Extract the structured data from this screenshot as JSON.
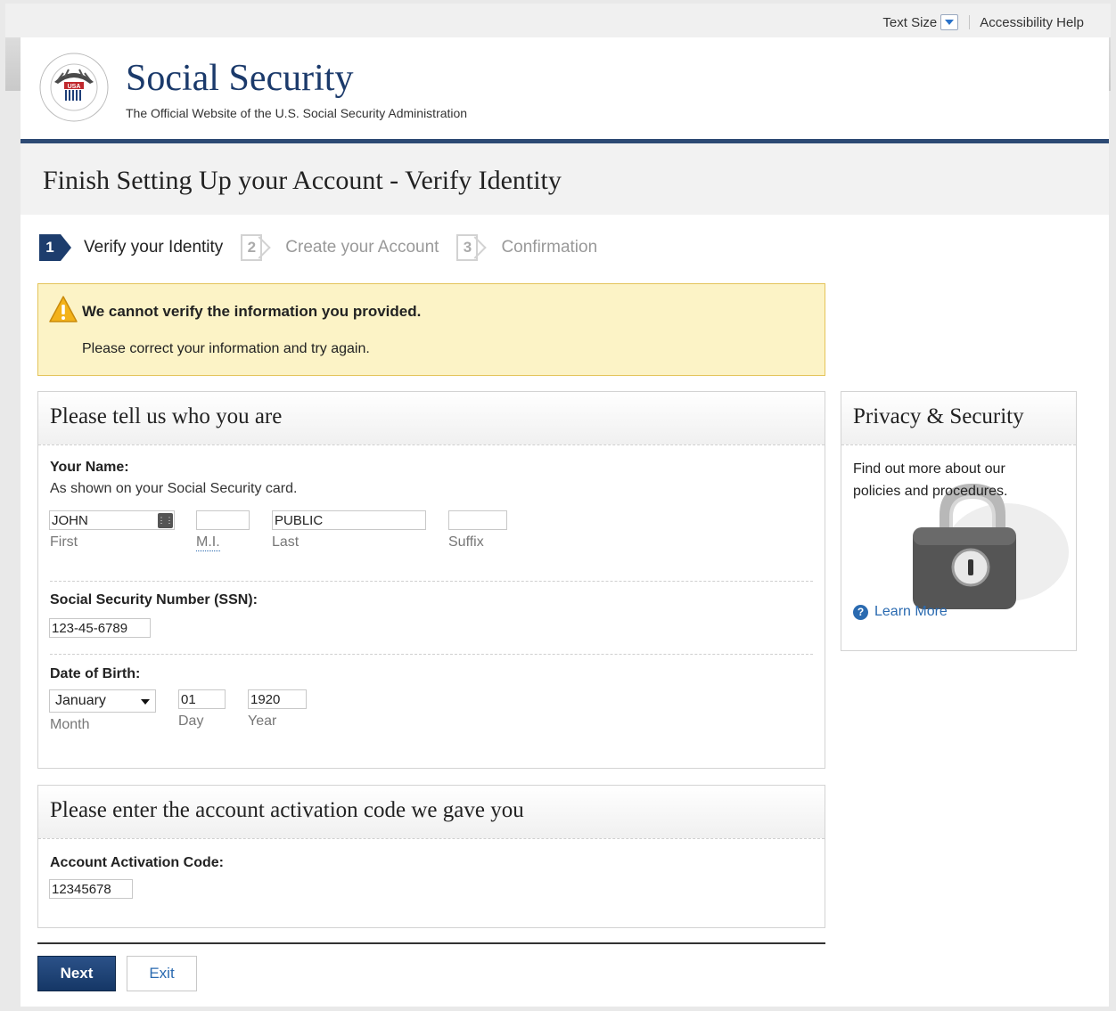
{
  "utility": {
    "text_size_label": "Text Size",
    "accessibility_label": "Accessibility Help"
  },
  "header": {
    "site_title": "Social Security",
    "site_subtitle": "The Official Website of the U.S. Social Security Administration",
    "seal_text": "SOCIAL SECURITY ADMINISTRATION",
    "seal_usa": "USA"
  },
  "page": {
    "title": "Finish Setting Up your Account - Verify Identity"
  },
  "steps": [
    {
      "number": "1",
      "label": "Verify your Identity",
      "state": "active"
    },
    {
      "number": "2",
      "label": "Create your Account",
      "state": "inactive"
    },
    {
      "number": "3",
      "label": "Confirmation",
      "state": "inactive"
    }
  ],
  "alert": {
    "title": "We cannot verify the information you provided.",
    "message": "Please correct your information and try again."
  },
  "identity_panel": {
    "heading": "Please tell us who you are",
    "name": {
      "label": "Your Name:",
      "hint": "As shown on your Social Security card.",
      "first_value": "JOHN",
      "first_label": "First",
      "mi_value": "",
      "mi_label": "M.I.",
      "last_value": "PUBLIC",
      "last_label": "Last",
      "suffix_value": "",
      "suffix_label": "Suffix"
    },
    "ssn": {
      "label": "Social Security Number (SSN):",
      "value": "123-45-6789"
    },
    "dob": {
      "label": "Date of Birth:",
      "month_value": "January",
      "month_label": "Month",
      "day_value": "01",
      "day_label": "Day",
      "year_value": "1920",
      "year_label": "Year"
    }
  },
  "activation_panel": {
    "heading": "Please enter the account activation code we gave you",
    "label": "Account Activation Code:",
    "value": "12345678"
  },
  "privacy_panel": {
    "heading": "Privacy & Security",
    "text": "Find out more about our policies and procedures.",
    "learn_more": "Learn More"
  },
  "buttons": {
    "next": "Next",
    "exit": "Exit"
  },
  "colors": {
    "brand_navy": "#1d3d6d",
    "alert_bg": "#fcf3c6",
    "link_blue": "#2a6ab0"
  }
}
